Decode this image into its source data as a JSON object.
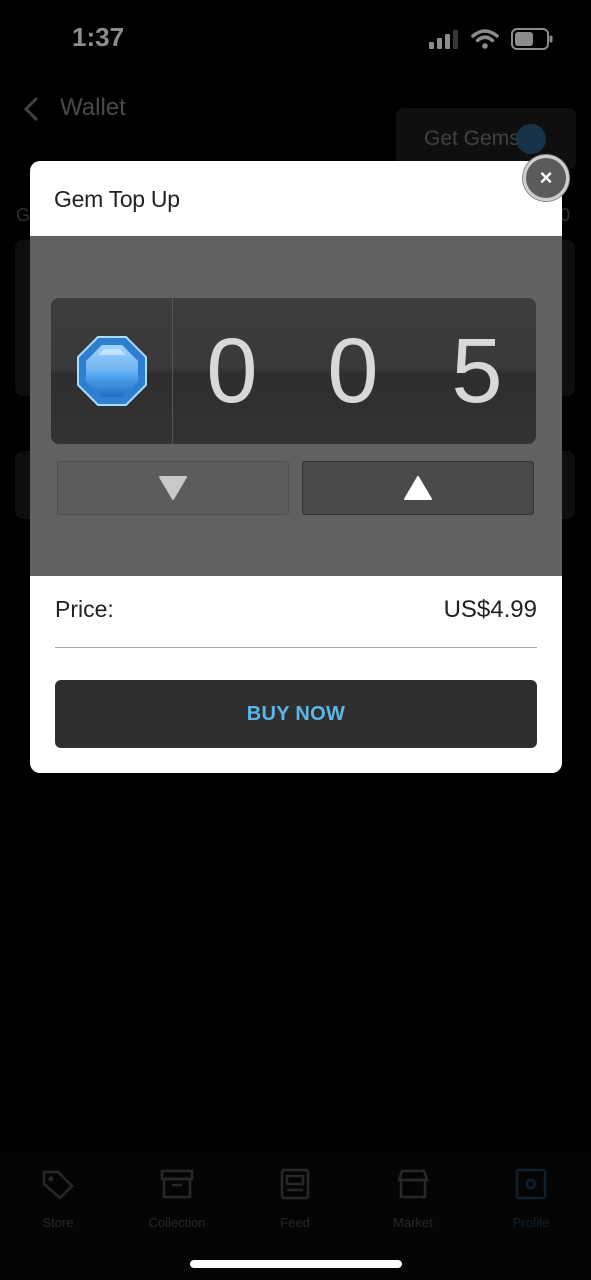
{
  "status_bar": {
    "time": "1:37"
  },
  "header": {
    "title": "Wallet",
    "get_gems_label": "Get Gems"
  },
  "background": {
    "left_label": "G",
    "right_label": "0"
  },
  "modal": {
    "title": "Gem Top Up",
    "close_symbol": "×",
    "counter": {
      "digits": [
        "0",
        "0",
        "5"
      ]
    },
    "price_label": "Price:",
    "price_value": "US$4.99",
    "buy_label": "BUY NOW"
  },
  "nav": {
    "items": [
      {
        "label": "Store",
        "icon": "tag-icon"
      },
      {
        "label": "Collection",
        "icon": "archive-icon"
      },
      {
        "label": "Feed",
        "icon": "feed-icon"
      },
      {
        "label": "Market",
        "icon": "market-icon"
      },
      {
        "label": "Profile",
        "icon": "profile-icon"
      }
    ]
  },
  "colors": {
    "accent": "#5bb8e6",
    "gem": "#3a8fe0"
  }
}
